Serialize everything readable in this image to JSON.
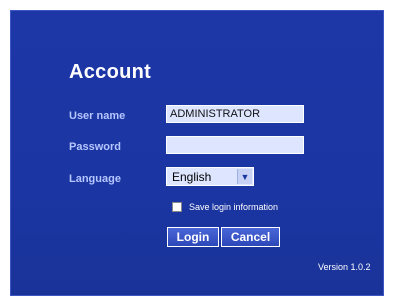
{
  "account": {
    "title": "Account",
    "user_name_label": "User name",
    "user_name_value": "ADMINISTRATOR",
    "password_label": "Password",
    "password_value": "",
    "language_label": "Language",
    "language_selected": "English",
    "save_login_label": "Save login information",
    "save_login_checked": false,
    "login_button": "Login",
    "cancel_button": "Cancel",
    "version": "Version 1.0.2"
  },
  "colors": {
    "panel_background": "#1b36a3",
    "label_color": "#b6c6ff",
    "field_background": "#dde5ff"
  },
  "icons": {
    "dropdown": "chevron-down-icon"
  }
}
